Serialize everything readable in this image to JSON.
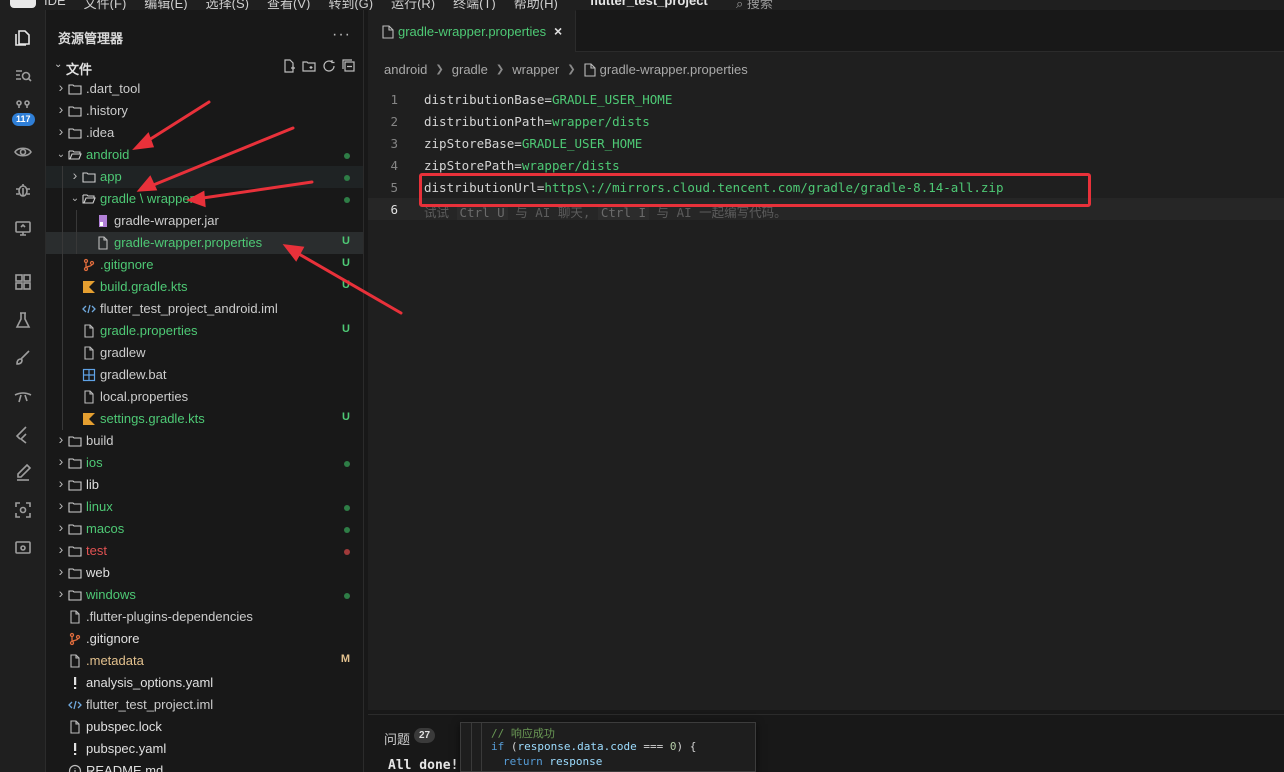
{
  "menubar": {
    "items": [
      "IDE",
      "文件(F)",
      "编辑(E)",
      "选择(S)",
      "查看(V)",
      "转到(G)",
      "运行(R)",
      "终端(T)",
      "帮助(H)"
    ],
    "project_title": "flutter_test_project",
    "search_placeholder": "搜索"
  },
  "activity_bar": {
    "icons": [
      "explorer-icon",
      "search-icon",
      "source-control-icon",
      "preview-icon",
      "debug-icon",
      "remote-icon",
      "extensions-icon",
      "testing-icon",
      "brush-icon",
      "flutter-bird-icon",
      "flutter-icon",
      "pen-icon",
      "scan-icon",
      "inspect-icon"
    ],
    "badge": "117"
  },
  "sidebar": {
    "title": "资源管理器",
    "more": "···",
    "workspace_label": "文件",
    "tree": [
      {
        "name": ".dart_tool",
        "type": "folder",
        "depth": 0,
        "expanded": false,
        "color": "#cccccc"
      },
      {
        "name": ".history",
        "type": "folder",
        "depth": 0,
        "expanded": false,
        "color": "#cccccc"
      },
      {
        "name": ".idea",
        "type": "folder",
        "depth": 0,
        "expanded": false,
        "color": "#cccccc"
      },
      {
        "name": "android",
        "type": "folder",
        "depth": 0,
        "expanded": true,
        "color": "#4ec975",
        "dot": "#2e7d46"
      },
      {
        "name": "app",
        "type": "folder",
        "depth": 1,
        "expanded": false,
        "color": "#4ec975",
        "dot": "#2e7d46",
        "hover": true
      },
      {
        "name": "gradle \\ wrapper",
        "type": "folder",
        "depth": 1,
        "expanded": true,
        "color": "#4ec975",
        "dot": "#2e7d46"
      },
      {
        "name": "gradle-wrapper.jar",
        "type": "jar",
        "depth": 2,
        "color": "#cccccc"
      },
      {
        "name": "gradle-wrapper.properties",
        "type": "file",
        "depth": 2,
        "color": "#4ec975",
        "status": "U",
        "selected": true
      },
      {
        "name": ".gitignore",
        "type": "git",
        "depth": 1,
        "color": "#4ec975",
        "status": "U"
      },
      {
        "name": "build.gradle.kts",
        "type": "kotlin",
        "depth": 1,
        "color": "#4ec975",
        "status": "U"
      },
      {
        "name": "flutter_test_project_android.iml",
        "type": "xml",
        "depth": 1,
        "color": "#cccccc"
      },
      {
        "name": "gradle.properties",
        "type": "file",
        "depth": 1,
        "color": "#4ec975",
        "status": "U"
      },
      {
        "name": "gradlew",
        "type": "file",
        "depth": 1,
        "color": "#cccccc"
      },
      {
        "name": "gradlew.bat",
        "type": "windows",
        "depth": 1,
        "color": "#cccccc"
      },
      {
        "name": "local.properties",
        "type": "file",
        "depth": 1,
        "color": "#cccccc"
      },
      {
        "name": "settings.gradle.kts",
        "type": "kotlin",
        "depth": 1,
        "color": "#4ec975",
        "status": "U"
      },
      {
        "name": "build",
        "type": "folder",
        "depth": 0,
        "expanded": false,
        "color": "#cccccc"
      },
      {
        "name": "ios",
        "type": "folder",
        "depth": 0,
        "expanded": false,
        "color": "#4ec975",
        "dot": "#2e7d46"
      },
      {
        "name": "lib",
        "type": "folder",
        "depth": 0,
        "expanded": false,
        "color": "#e0e0e0"
      },
      {
        "name": "linux",
        "type": "folder",
        "depth": 0,
        "expanded": false,
        "color": "#4ec975",
        "dot": "#2e7d46"
      },
      {
        "name": "macos",
        "type": "folder",
        "depth": 0,
        "expanded": false,
        "color": "#4ec975",
        "dot": "#2e7d46"
      },
      {
        "name": "test",
        "type": "folder",
        "depth": 0,
        "expanded": false,
        "color": "#e05252",
        "dot": "#a03a3a"
      },
      {
        "name": "web",
        "type": "folder",
        "depth": 0,
        "expanded": false,
        "color": "#e0e0e0"
      },
      {
        "name": "windows",
        "type": "folder",
        "depth": 0,
        "expanded": false,
        "color": "#4ec975",
        "dot": "#2e7d46"
      },
      {
        "name": ".flutter-plugins-dependencies",
        "type": "file",
        "depth": 0,
        "color": "#cccccc"
      },
      {
        "name": ".gitignore",
        "type": "git",
        "depth": 0,
        "color": "#e0e0e0"
      },
      {
        "name": ".metadata",
        "type": "file",
        "depth": 0,
        "color": "#e2c08d",
        "status": "M"
      },
      {
        "name": "analysis_options.yaml",
        "type": "yaml",
        "depth": 0,
        "color": "#e0e0e0"
      },
      {
        "name": "flutter_test_project.iml",
        "type": "xml",
        "depth": 0,
        "color": "#cccccc"
      },
      {
        "name": "pubspec.lock",
        "type": "file",
        "depth": 0,
        "color": "#e0e0e0"
      },
      {
        "name": "pubspec.yaml",
        "type": "yaml",
        "depth": 0,
        "color": "#e0e0e0"
      },
      {
        "name": "README.md",
        "type": "info",
        "depth": 0,
        "color": "#e0e0e0"
      }
    ]
  },
  "editor": {
    "tab_label": "gradle-wrapper.properties",
    "tab_close": "×",
    "breadcrumb": [
      "android",
      "gradle",
      "wrapper",
      "gradle-wrapper.properties"
    ],
    "lines": [
      {
        "num": "1",
        "key": "distributionBase=",
        "value": "GRADLE_USER_HOME"
      },
      {
        "num": "2",
        "key": "distributionPath=",
        "value": "wrapper/dists"
      },
      {
        "num": "3",
        "key": "zipStoreBase=",
        "value": "GRADLE_USER_HOME"
      },
      {
        "num": "4",
        "key": "zipStorePath=",
        "value": "wrapper/dists"
      },
      {
        "num": "5",
        "key": "distributionUrl=",
        "value": "https\\://mirrors.cloud.tencent.com/gradle/gradle-8.14-all.zip"
      },
      {
        "num": "6",
        "key": "",
        "value": ""
      }
    ],
    "hint": {
      "p1": "试试 ",
      "k1": "Ctrl U",
      "p2": " 与 AI 聊天, ",
      "k2": "Ctrl I",
      "p3": " 与 AI 一起编写代码。"
    }
  },
  "panel": {
    "tab_label": "问题",
    "tab_count": "27",
    "output": "All done!"
  },
  "popup": {
    "line1": "// 响应成功",
    "line2": {
      "kw": "if",
      "a": " (",
      "id": "response.data.code",
      "op": " === ",
      "num": "0",
      "b": ") {"
    },
    "line3": {
      "kw": "return",
      "id": " response"
    }
  },
  "colors": {
    "accent_green": "#4ec975",
    "annotation_red": "#e8313a",
    "badge_blue": "#2f7fd7"
  }
}
